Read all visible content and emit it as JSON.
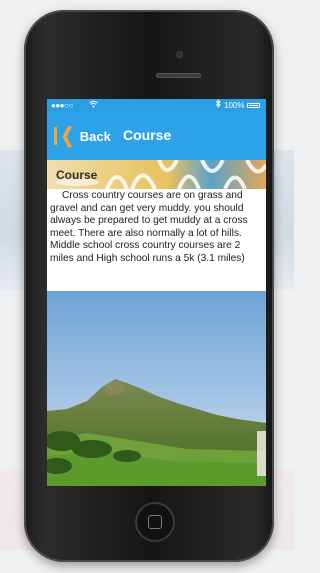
{
  "status_bar": {
    "signal": "●●●○○",
    "battery_text": "100%",
    "wifi_icon": "wifi-icon",
    "bluetooth_icon": "bluetooth-icon"
  },
  "nav": {
    "back_label": "Back",
    "title": "Course"
  },
  "banner": {
    "title": "Course"
  },
  "content": {
    "paragraph": "Cross country courses are on grass and gravel and can get very muddy. you should always be prepared to get muddy at a cross meet. There are also normally a lot of hills. Middle school cross country courses are 2 miles and High school runs a 5k (3.1 miles)"
  },
  "colors": {
    "nav_bg": "#2da2e8",
    "accent": "#f2a63a",
    "phone_body": "#151515"
  }
}
